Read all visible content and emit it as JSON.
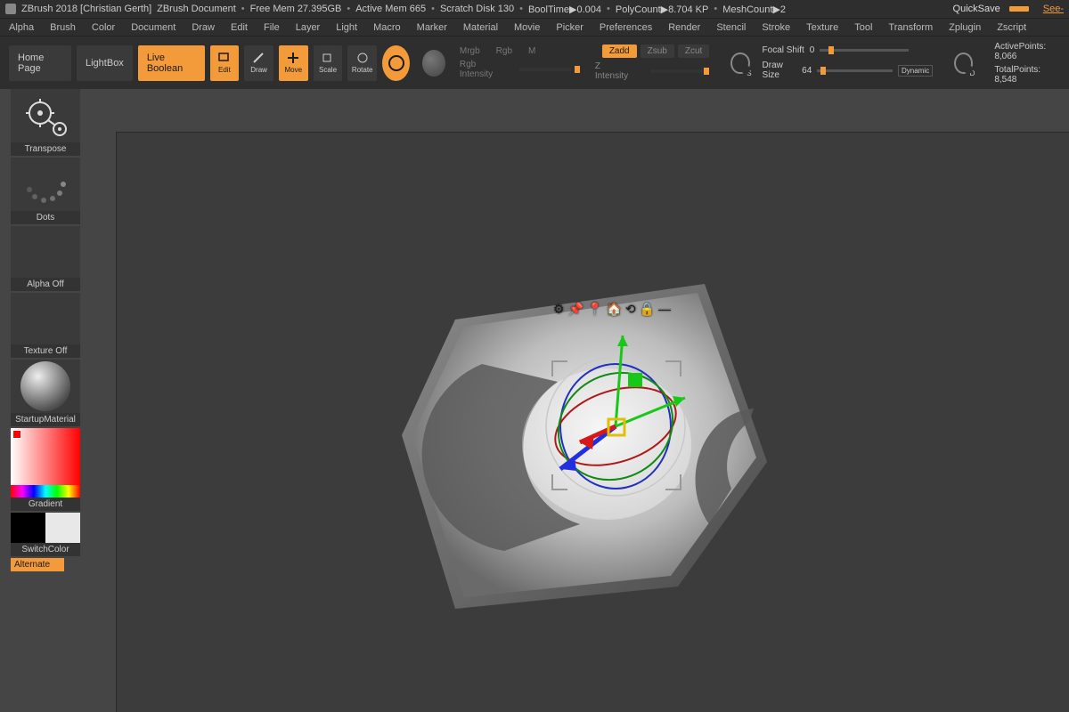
{
  "title": {
    "app": "ZBrush 2018 [Christian Gerth]",
    "doc": "ZBrush Document",
    "freemem": "Free Mem 27.395GB",
    "activemem": "Active Mem 665",
    "scratch": "Scratch Disk 130",
    "booltime": "BoolTime▶0.004",
    "polycount": "PolyCount▶8.704 KP",
    "meshcount": "MeshCount▶2",
    "quicksave": "QuickSave",
    "seethru": "See-"
  },
  "menu": [
    "Alpha",
    "Brush",
    "Color",
    "Document",
    "Draw",
    "Edit",
    "File",
    "Layer",
    "Light",
    "Macro",
    "Marker",
    "Material",
    "Movie",
    "Picker",
    "Preferences",
    "Render",
    "Stencil",
    "Stroke",
    "Texture",
    "Tool",
    "Transform",
    "Zplugin",
    "Zscript"
  ],
  "toolbar": {
    "home": "Home Page",
    "lightbox": "LightBox",
    "liveboolean": "Live Boolean",
    "edit": "Edit",
    "draw": "Draw",
    "move": "Move",
    "scale": "Scale",
    "rotate": "Rotate",
    "mrgb": "Mrgb",
    "rgb": "Rgb",
    "m": "M",
    "rgbint": "Rgb Intensity",
    "zadd": "Zadd",
    "zsub": "Zsub",
    "zcut": "Zcut",
    "zint": "Z Intensity",
    "focalshift": "Focal Shift",
    "focalshift_v": "0",
    "drawsize": "Draw Size",
    "drawsize_v": "64",
    "dynamic": "Dynamic",
    "activepoints_l": "ActivePoints:",
    "activepoints_v": "8,066",
    "totalpoints_l": "TotalPoints:",
    "totalpoints_v": "8,548",
    "dial_s": "S",
    "dial_d": "D"
  },
  "left": {
    "transpose": "Transpose",
    "dots": "Dots",
    "alphaoff": "Alpha Off",
    "textureoff": "Texture Off",
    "startupmat": "StartupMaterial",
    "gradient": "Gradient",
    "switchcolor": "SwitchColor",
    "alternate": "Alternate"
  },
  "gizmo_icons": [
    "⚙",
    "📌",
    "📍",
    "🏠",
    "⟲",
    "🔒",
    "—"
  ]
}
